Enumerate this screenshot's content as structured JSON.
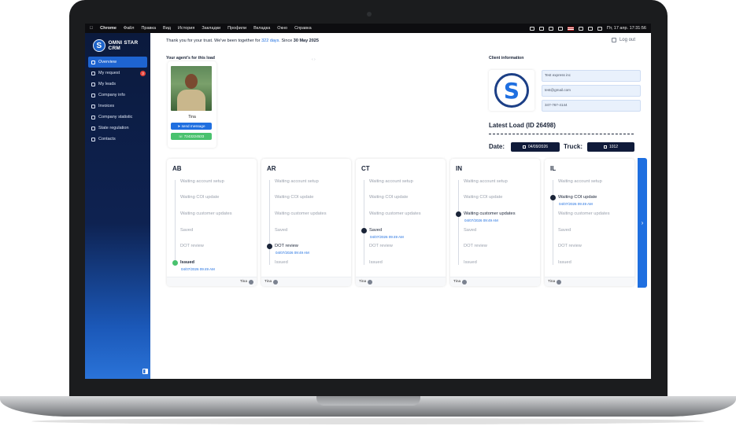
{
  "menubar": {
    "app": "Chrome",
    "items": [
      "Файл",
      "Правка",
      "Вид",
      "История",
      "Закладки",
      "Профили",
      "Вкладка",
      "Окно",
      "Справка"
    ],
    "clock": "Пт, 17 апр.  17:31:56"
  },
  "sidebar": {
    "brand": "OMNI STAR CRM",
    "logo_letter": "S",
    "items": [
      {
        "label": "Overview",
        "icon": "dashboard-icon",
        "active": true
      },
      {
        "label": "My request",
        "icon": "document-icon",
        "badge": "3"
      },
      {
        "label": "My leads",
        "icon": "truck-icon"
      },
      {
        "label": "Company info",
        "icon": "info-icon"
      },
      {
        "label": "Invoices",
        "icon": "dollar-icon"
      },
      {
        "label": "Company statistic",
        "icon": "chart-icon"
      },
      {
        "label": "State regulation",
        "icon": "building-icon"
      },
      {
        "label": "Contacts",
        "icon": "users-icon"
      }
    ]
  },
  "header": {
    "thanks_prefix": "Thank you for your trust. We've been together for ",
    "days": "322 days.",
    "since_label": " Since ",
    "since_date": "30 May 2025",
    "logout": "Log out"
  },
  "agent": {
    "section_title": "Your agent's for this load",
    "name": "Tina",
    "send_message": "send message",
    "phone": "7243224533"
  },
  "client": {
    "section_title": "Client information",
    "logo_letter": "S",
    "company": "Test express inc",
    "email": "test@gmail.com",
    "phone": "347-767-4144"
  },
  "load": {
    "title": "Latest Load (ID 26498)",
    "date_label": "Date:",
    "date_value": "04/09/2026",
    "truck_label": "Truck:",
    "truck_value": "1012"
  },
  "states": [
    {
      "code": "AB",
      "steps": [
        "Waiting account setup",
        "Waiting COI update",
        "Waiting customer updates",
        "Saved",
        "DOT review",
        "Issued"
      ],
      "active_index": 5,
      "active_date": "04/07/2026 09:49 AM",
      "agent": "Tina",
      "footer_align": "right"
    },
    {
      "code": "AR",
      "steps": [
        "Waiting account setup",
        "Waiting COI update",
        "Waiting customer updates",
        "Saved",
        "DOT review",
        "Issued"
      ],
      "active_index": 4,
      "active_date": "04/07/2026 09:49 AM",
      "agent": "Tina",
      "footer_align": "left"
    },
    {
      "code": "CT",
      "steps": [
        "Waiting account setup",
        "Waiting COI update",
        "Waiting customer updates",
        "Saved",
        "DOT review",
        "Issued"
      ],
      "active_index": 3,
      "active_date": "04/07/2026 09:49 AM",
      "agent": "Tina",
      "footer_align": "left"
    },
    {
      "code": "IN",
      "steps": [
        "Waiting account setup",
        "Waiting COI update",
        "Waiting customer updates",
        "Saved",
        "DOT review",
        "Issued"
      ],
      "active_index": 2,
      "active_date": "04/07/2026 09:49 AM",
      "agent": "Tina",
      "footer_align": "left"
    },
    {
      "code": "IL",
      "steps": [
        "Waiting account setup",
        "Waiting COI update",
        "Waiting customer updates",
        "Saved",
        "DOT review",
        "Issued"
      ],
      "active_index": 1,
      "active_date": "04/07/2026 09:49 AM",
      "agent": "Tina",
      "footer_align": "left"
    }
  ],
  "colors": {
    "accent": "#1f6fe0",
    "sidebar_dark": "#0b1a3d",
    "success": "#49c26e",
    "badge": "#e5443b"
  }
}
